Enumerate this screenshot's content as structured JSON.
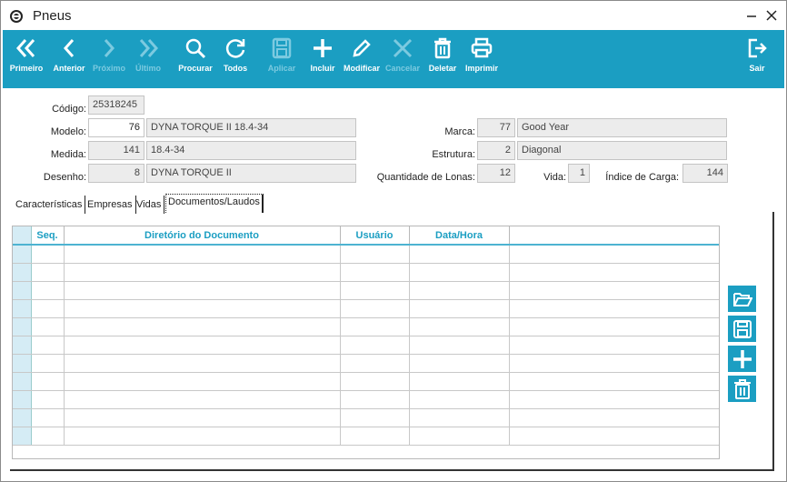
{
  "window": {
    "title": "Pneus"
  },
  "toolbar": {
    "buttons": [
      {
        "label": "Primeiro",
        "icon": "double-chevron-left-icon",
        "enabled": true
      },
      {
        "label": "Anterior",
        "icon": "chevron-left-icon",
        "enabled": true
      },
      {
        "label": "Próximo",
        "icon": "chevron-right-icon",
        "enabled": false
      },
      {
        "label": "Último",
        "icon": "double-chevron-right-icon",
        "enabled": false
      },
      {
        "label": "Procurar",
        "icon": "search-icon",
        "enabled": true
      },
      {
        "label": "Todos",
        "icon": "refresh-icon",
        "enabled": true
      },
      {
        "label": "Aplicar",
        "icon": "floppy-disk-icon",
        "enabled": false
      },
      {
        "label": "Incluir",
        "icon": "plus-icon",
        "enabled": true
      },
      {
        "label": "Modificar",
        "icon": "pencil-icon",
        "enabled": true
      },
      {
        "label": "Cancelar",
        "icon": "x-icon",
        "enabled": false
      },
      {
        "label": "Deletar",
        "icon": "trash-icon",
        "enabled": true
      },
      {
        "label": "Imprimir",
        "icon": "printer-icon",
        "enabled": true
      }
    ],
    "exit": {
      "label": "Sair",
      "icon": "exit-icon"
    }
  },
  "form": {
    "codigo": {
      "label": "Código:",
      "value": "25318245"
    },
    "modelo": {
      "label": "Modelo:",
      "code": "76",
      "name": "DYNA TORQUE II 18.4-34"
    },
    "medida": {
      "label": "Medida:",
      "code": "141",
      "name": "18.4-34"
    },
    "desenho": {
      "label": "Desenho:",
      "code": "8",
      "name": "DYNA TORQUE II"
    },
    "marca": {
      "label": "Marca:",
      "code": "77",
      "name": "Good Year"
    },
    "estrutura": {
      "label": "Estrutura:",
      "code": "2",
      "name": "Diagonal"
    },
    "lonas": {
      "label": "Quantidade de Lonas:",
      "value": "12"
    },
    "vida": {
      "label": "Vida:",
      "value": "1"
    },
    "carga": {
      "label": "Índice de Carga:",
      "value": "144"
    }
  },
  "tabs": [
    {
      "label": "Características",
      "active": false
    },
    {
      "label": "Empresas",
      "active": false
    },
    {
      "label": "Vidas",
      "active": false
    },
    {
      "label": "Documentos/Laudos",
      "active": true
    }
  ],
  "grid": {
    "columns": [
      "Seq.",
      "Diretório do Documento",
      "Usuário",
      "Data/Hora",
      ""
    ],
    "row_count": 11
  },
  "side_buttons": [
    {
      "name": "open-folder-button",
      "icon": "folder-open-icon"
    },
    {
      "name": "save-document-button",
      "icon": "floppy-disk-icon"
    },
    {
      "name": "add-document-button",
      "icon": "plus-icon"
    },
    {
      "name": "delete-document-button",
      "icon": "trash-icon"
    }
  ],
  "colors": {
    "toolbar": "#1b9ec2",
    "disabled": "#7ccae0",
    "grid_header_text": "#1b9ec2"
  }
}
